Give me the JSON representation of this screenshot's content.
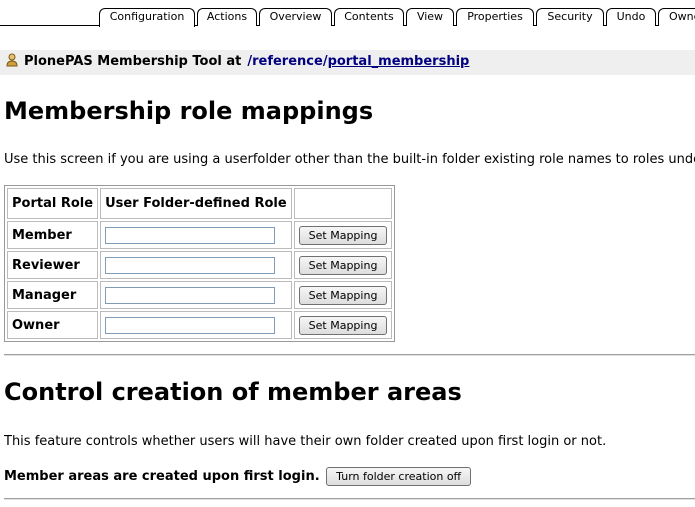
{
  "tabs": [
    {
      "label": "Configuration",
      "active": true
    },
    {
      "label": "Actions"
    },
    {
      "label": "Overview"
    },
    {
      "label": "Contents"
    },
    {
      "label": "View"
    },
    {
      "label": "Properties"
    },
    {
      "label": "Security"
    },
    {
      "label": "Undo"
    },
    {
      "label": "Owne"
    }
  ],
  "header": {
    "title": "PlonePAS Membership Tool at",
    "path_prefix": "/reference/",
    "path_link": "portal_membership"
  },
  "roles_section": {
    "heading": "Membership role mappings",
    "intro": "Use this screen if you are using a userfolder other than the built-in folder existing role names to roles understo",
    "table": {
      "headers": [
        "Portal Role",
        "User Folder-defined Role",
        ""
      ],
      "rows": [
        {
          "role": "Member",
          "value": "",
          "button": "Set Mapping"
        },
        {
          "role": "Reviewer",
          "value": "",
          "button": "Set Mapping"
        },
        {
          "role": "Manager",
          "value": "",
          "button": "Set Mapping"
        },
        {
          "role": "Owner",
          "value": "",
          "button": "Set Mapping"
        }
      ]
    }
  },
  "areas_section": {
    "heading": "Control creation of member areas",
    "description": "This feature controls whether users will have their own folder created upon first login or not.",
    "status": "Member areas are created upon first login.",
    "button": "Turn folder creation off"
  }
}
